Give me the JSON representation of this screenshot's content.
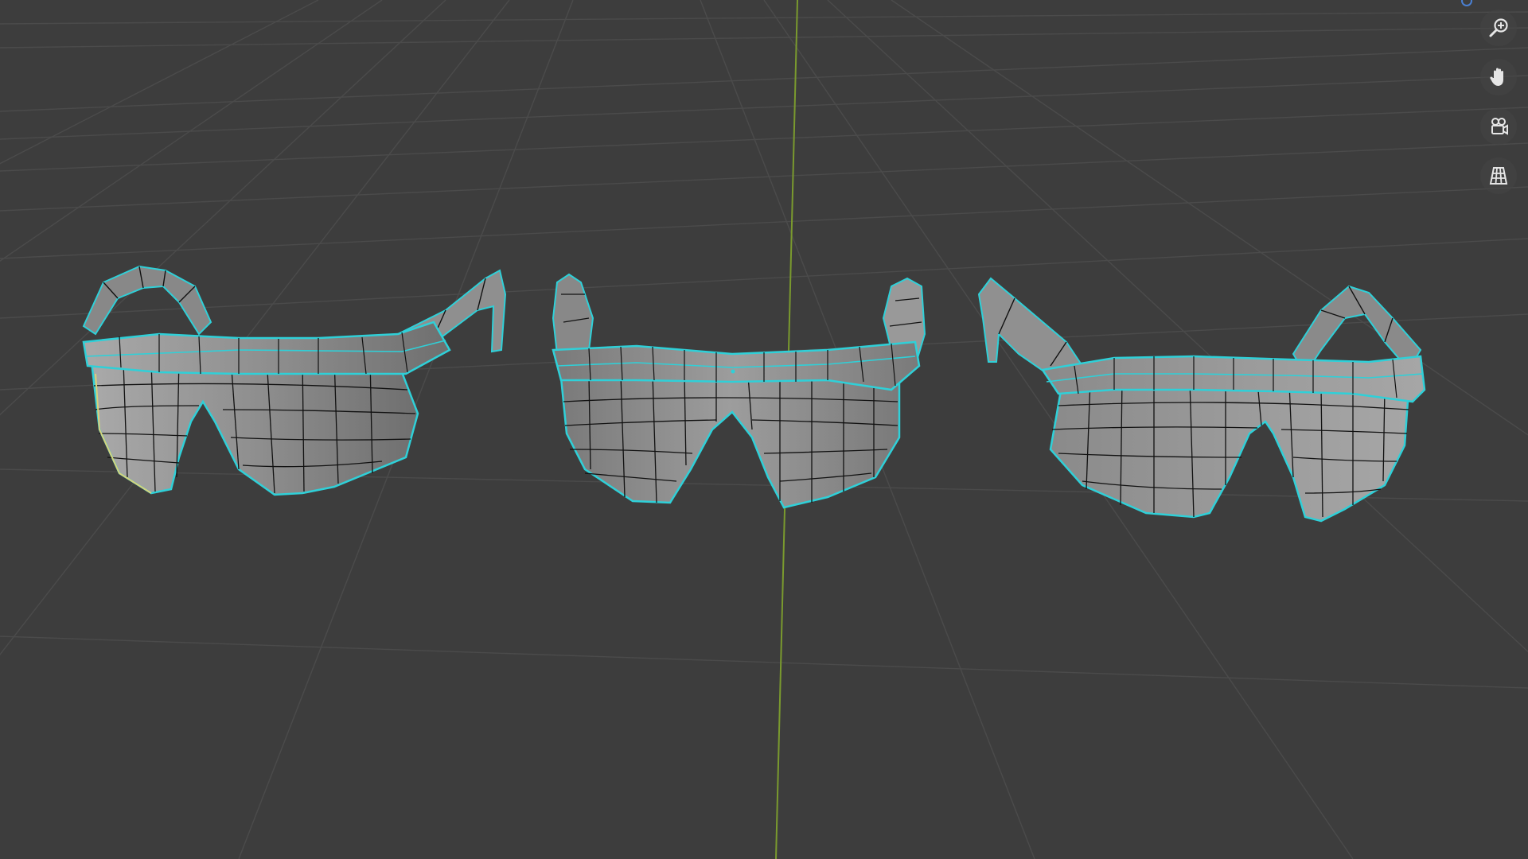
{
  "viewport": {
    "background": "#3d3d3d",
    "grid_color": "#4a4a4a",
    "axis_y_color": "#7a9a2e",
    "outline_color": "#2fd0d8",
    "mesh_face_color": "#8c8c8c",
    "mesh_edge_color": "#111111"
  },
  "objects": [
    {
      "name": "glasses-left",
      "view": "three-quarter-left"
    },
    {
      "name": "glasses-center",
      "view": "front"
    },
    {
      "name": "glasses-right",
      "view": "three-quarter-right"
    }
  ],
  "navigation": {
    "buttons": [
      {
        "name": "zoom-button",
        "icon": "zoom-icon"
      },
      {
        "name": "pan-button",
        "icon": "hand-icon"
      },
      {
        "name": "camera-button",
        "icon": "camera-icon"
      },
      {
        "name": "ortho-toggle-button",
        "icon": "grid-icon"
      }
    ]
  }
}
